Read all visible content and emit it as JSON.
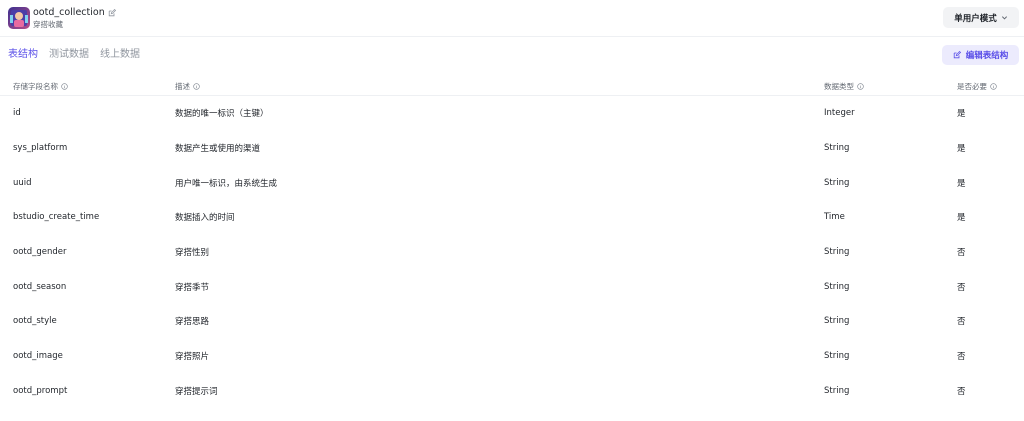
{
  "header": {
    "title": "ootd_collection",
    "subtitle": "穿搭收藏",
    "mode_label": "单用户模式",
    "app_icon": "app-avatar-icon",
    "edit_icon": "edit-icon",
    "mode_chevron_icon": "chevron-down-icon"
  },
  "tabs": [
    {
      "label": "表结构",
      "active": true
    },
    {
      "label": "测试数据",
      "active": false
    },
    {
      "label": "线上数据",
      "active": false
    }
  ],
  "edit_button": {
    "label": "编辑表结构",
    "icon": "edit-icon"
  },
  "colors": {
    "accent": "#5a4fe8",
    "accent_bg": "#ecebfd",
    "muted": "#8f959e"
  },
  "table": {
    "columns": [
      "存储字段名称",
      "描述",
      "数据类型",
      "是否必要"
    ],
    "info_icon": "info-circle-icon",
    "rows": [
      {
        "name": "id",
        "desc": "数据的唯一标识（主键）",
        "type": "Integer",
        "required": "是"
      },
      {
        "name": "sys_platform",
        "desc": "数据产生或使用的渠道",
        "type": "String",
        "required": "是"
      },
      {
        "name": "uuid",
        "desc": "用户唯一标识，由系统生成",
        "type": "String",
        "required": "是"
      },
      {
        "name": "bstudio_create_time",
        "desc": "数据插入的时间",
        "type": "Time",
        "required": "是"
      },
      {
        "name": "ootd_gender",
        "desc": "穿搭性别",
        "type": "String",
        "required": "否"
      },
      {
        "name": "ootd_season",
        "desc": "穿搭季节",
        "type": "String",
        "required": "否"
      },
      {
        "name": "ootd_style",
        "desc": "穿搭思路",
        "type": "String",
        "required": "否"
      },
      {
        "name": "ootd_image",
        "desc": "穿搭照片",
        "type": "String",
        "required": "否"
      },
      {
        "name": "ootd_prompt",
        "desc": "穿搭提示词",
        "type": "String",
        "required": "否"
      }
    ]
  }
}
